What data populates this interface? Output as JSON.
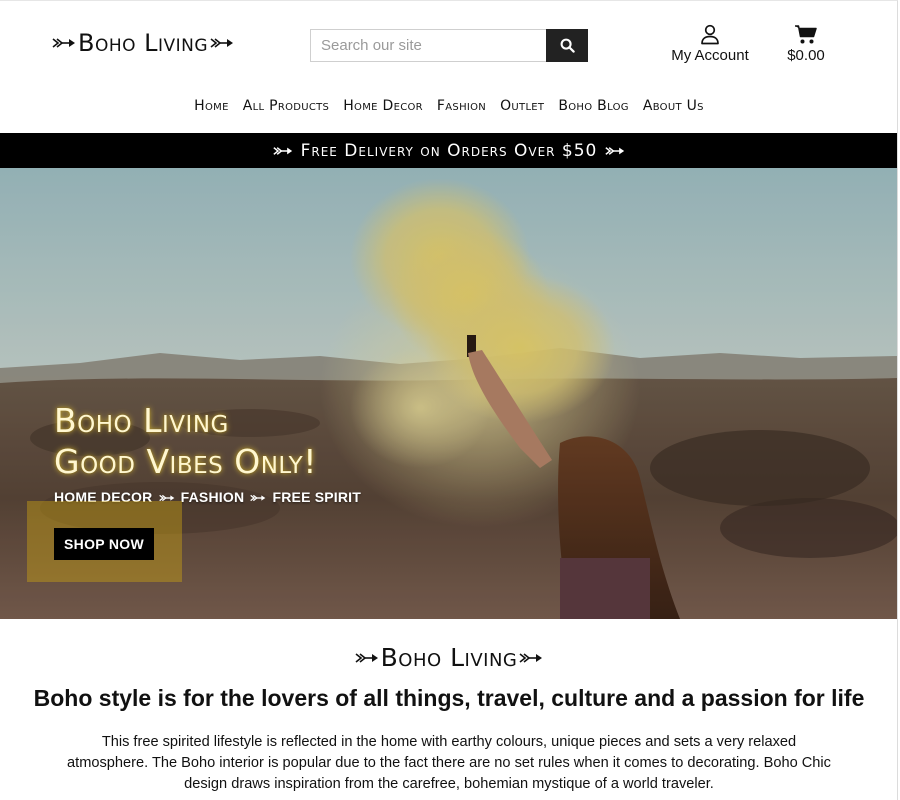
{
  "header": {
    "logo_text": "Boho Living",
    "search": {
      "placeholder": "Search our site",
      "value": ""
    },
    "account_label": "My Account",
    "cart_total": "$0.00"
  },
  "nav": {
    "items": [
      {
        "label": "Home"
      },
      {
        "label": "All Products"
      },
      {
        "label": "Home Decor"
      },
      {
        "label": "Fashion"
      },
      {
        "label": "Outlet"
      },
      {
        "label": "Boho Blog"
      },
      {
        "label": "About Us"
      }
    ]
  },
  "promo": {
    "text": "Free Delivery on Orders Over $50"
  },
  "hero": {
    "title_line1": "Boho Living",
    "title_line2": "Good Vibes Only!",
    "subtitle_part1": "HOME DECOR",
    "subtitle_part2": "FASHION",
    "subtitle_part3": "FREE SPIRIT",
    "cta_label": "SHOP NOW"
  },
  "intro": {
    "logo_text": "Boho Living",
    "heading": "Boho style is for the lovers of all things, travel, culture and a passion for life",
    "body": "This free spirited lifestyle is reflected in the home with earthy colours, unique pieces and sets a very relaxed atmosphere. The Boho interior is popular due to the fact there are no set rules when it comes to decorating. Boho Chic design draws inspiration from the carefree, bohemian mystique of a world traveler."
  },
  "colors": {
    "promo_bg": "#000000",
    "search_button_bg": "#222222",
    "hero_title": "#fff7d0",
    "hero_glow": "#e6c83c",
    "shop_wrap": "#c8a014"
  },
  "icons": {
    "logo_arrow": "arrow-icon",
    "search": "search-icon",
    "account": "user-icon",
    "cart": "cart-icon"
  }
}
